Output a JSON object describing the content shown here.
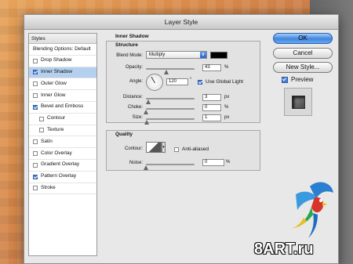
{
  "window": {
    "title": "Layer Style"
  },
  "style_list": {
    "header": "Styles",
    "items": [
      {
        "label": "Blending Options: Default",
        "checkbox": false,
        "checked": false,
        "indent": false,
        "selected": false
      },
      {
        "label": "Drop Shadow",
        "checkbox": true,
        "checked": false,
        "indent": false,
        "selected": false
      },
      {
        "label": "Inner Shadow",
        "checkbox": true,
        "checked": true,
        "indent": false,
        "selected": true
      },
      {
        "label": "Outer Glow",
        "checkbox": true,
        "checked": false,
        "indent": false,
        "selected": false
      },
      {
        "label": "Inner Glow",
        "checkbox": true,
        "checked": false,
        "indent": false,
        "selected": false
      },
      {
        "label": "Bevel and Emboss",
        "checkbox": true,
        "checked": true,
        "indent": false,
        "selected": false
      },
      {
        "label": "Contour",
        "checkbox": true,
        "checked": false,
        "indent": true,
        "selected": false
      },
      {
        "label": "Texture",
        "checkbox": true,
        "checked": false,
        "indent": true,
        "selected": false
      },
      {
        "label": "Satin",
        "checkbox": true,
        "checked": false,
        "indent": false,
        "selected": false
      },
      {
        "label": "Color Overlay",
        "checkbox": true,
        "checked": false,
        "indent": false,
        "selected": false
      },
      {
        "label": "Gradient Overlay",
        "checkbox": true,
        "checked": false,
        "indent": false,
        "selected": false
      },
      {
        "label": "Pattern Overlay",
        "checkbox": true,
        "checked": true,
        "indent": false,
        "selected": false
      },
      {
        "label": "Stroke",
        "checkbox": true,
        "checked": false,
        "indent": false,
        "selected": false
      }
    ]
  },
  "inner_shadow": {
    "title": "Inner Shadow",
    "structure": {
      "title": "Structure",
      "blend_mode_label": "Blend Mode:",
      "blend_mode_value": "Multiply",
      "shadow_color": "#000000",
      "opacity_label": "Opacity:",
      "opacity_value": "43",
      "opacity_unit": "%",
      "opacity_level": 0.43,
      "angle_label": "Angle:",
      "angle_value": "120",
      "angle_unit": "°",
      "use_global_light_label": "Use Global Light",
      "use_global_light_checked": true,
      "distance_label": "Distance:",
      "distance_value": "3",
      "distance_unit": "px",
      "choke_label": "Choke:",
      "choke_value": "0",
      "choke_unit": "%",
      "size_label": "Size:",
      "size_value": "1",
      "size_unit": "px"
    },
    "quality": {
      "title": "Quality",
      "contour_label": "Contour:",
      "anti_aliased_label": "Anti-aliased",
      "anti_aliased_checked": false,
      "noise_label": "Noise:",
      "noise_value": "0",
      "noise_unit": "%"
    }
  },
  "buttons": {
    "ok": "OK",
    "cancel": "Cancel",
    "new_style": "New Style...",
    "preview_label": "Preview",
    "preview_checked": true
  },
  "watermark": "8ART.ru",
  "colors": {
    "selection": "#b4d0ee",
    "accent": "#3d86e0"
  }
}
